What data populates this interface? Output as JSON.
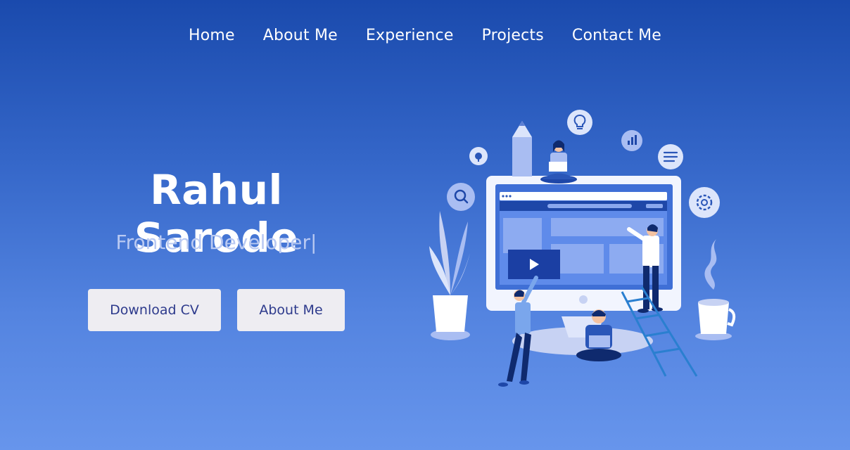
{
  "nav": {
    "items": [
      {
        "label": "Home"
      },
      {
        "label": "About Me"
      },
      {
        "label": "Experience"
      },
      {
        "label": "Projects"
      },
      {
        "label": "Contact Me"
      }
    ]
  },
  "hero": {
    "name": "Rahul Sarode",
    "role": "Frontend Developer|",
    "buttons": {
      "download_cv": "Download CV",
      "about_me": "About Me"
    }
  },
  "illustration": {
    "icons": [
      "pencil-icon",
      "lightbulb-icon",
      "chart-icon",
      "menu-icon",
      "search-icon",
      "settings-icon",
      "upload-icon",
      "play-icon"
    ]
  },
  "colors": {
    "bg_top": "#1a4aad",
    "bg_bottom": "#6795ec",
    "button_bg": "#eeedf2",
    "button_text": "#2d3a8c"
  }
}
